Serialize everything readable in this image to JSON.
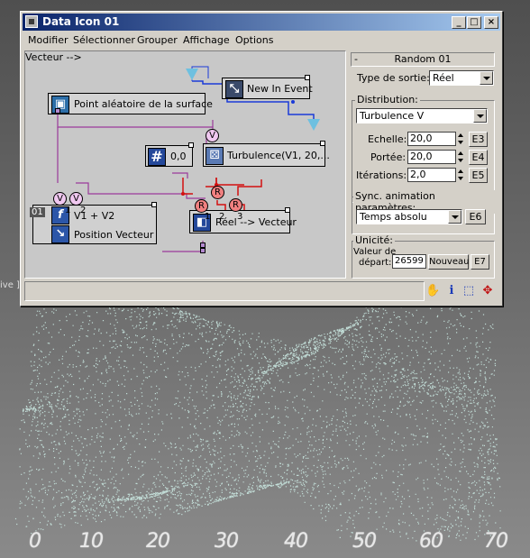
{
  "window": {
    "title": "Data Icon 01"
  },
  "menu": [
    "Modifier",
    "Sélectionner",
    "Grouper",
    "Affichage",
    "Options"
  ],
  "viewport": {
    "label": "ive ]",
    "axis_ticks": [
      "0",
      "10",
      "20",
      "30",
      "40",
      "50",
      "60",
      "70"
    ]
  },
  "graph": {
    "nodes": {
      "surface": "Point aléatoire de la surface",
      "event": "New In Event",
      "const_value": "0,0",
      "turbulence": "Turbulence(V1, 20,...",
      "expr": "V1 + V2",
      "expr_sub": "Position Vecteur",
      "expr_index": "01",
      "converter": "Réel --> Vecteur"
    },
    "port_labels": {
      "v": "V",
      "r": "R",
      "p1": "1",
      "p2": "2",
      "p3": "3"
    }
  },
  "panel": {
    "rollout_title": "Random 01",
    "rollout_minus": "-",
    "output_type_label": "Type de sortie:",
    "output_type_value": "Réel",
    "distribution_label": "Distribution:",
    "distribution_value": "Turbulence V",
    "scale_label": "Echelle:",
    "scale_value": "20,0",
    "scale_btn": "E3",
    "range_label": "Portée:",
    "range_value": "20,0",
    "range_btn": "E4",
    "iter_label": "Itérations:",
    "iter_value": "2,0",
    "iter_btn": "E5",
    "sync_label": "Sync. animation paramètres:",
    "sync_value": "Temps absolu",
    "sync_btn": "E6",
    "unique_label": "Unicité:",
    "seed_label_1": "Valeur de",
    "seed_label_2": "départ:",
    "seed_value": "26599",
    "new_btn": "Nouveau",
    "seed_btn": "E7"
  },
  "statusbar": {
    "text": "",
    "icons": [
      "hand-pan-icon",
      "info-icon",
      "zoom-region-icon",
      "move-icon"
    ]
  }
}
